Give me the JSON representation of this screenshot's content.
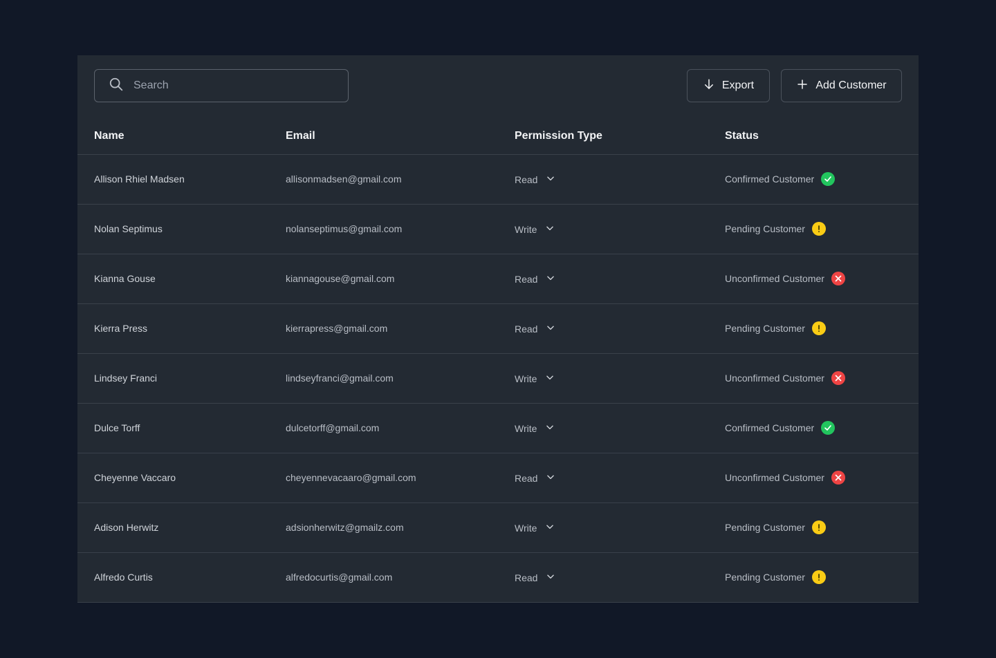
{
  "toolbar": {
    "search_placeholder": "Search",
    "export_label": "Export",
    "add_label": "Add Customer"
  },
  "columns": {
    "name": "Name",
    "email": "Email",
    "permission": "Permission Type",
    "status": "Status"
  },
  "rows": [
    {
      "name": "Allison Rhiel Madsen",
      "email": "allisonmadsen@gmail.com",
      "permission": "Read",
      "status": "Confirmed Customer",
      "status_kind": "confirmed"
    },
    {
      "name": "Nolan Septimus",
      "email": "nolanseptimus@gmail.com",
      "permission": "Write",
      "status": "Pending Customer",
      "status_kind": "pending"
    },
    {
      "name": "Kianna Gouse",
      "email": "kiannagouse@gmail.com",
      "permission": "Read",
      "status": "Unconfirmed Customer",
      "status_kind": "unconfirmed"
    },
    {
      "name": "Kierra Press",
      "email": "kierrapress@gmail.com",
      "permission": "Read",
      "status": "Pending Customer",
      "status_kind": "pending"
    },
    {
      "name": "Lindsey Franci",
      "email": "lindseyfranci@gmail.com",
      "permission": "Write",
      "status": "Unconfirmed Customer",
      "status_kind": "unconfirmed"
    },
    {
      "name": "Dulce Torff",
      "email": "dulcetorff@gmail.com",
      "permission": "Write",
      "status": "Confirmed Customer",
      "status_kind": "confirmed"
    },
    {
      "name": "Cheyenne Vaccaro",
      "email": "cheyennevacaaro@gmail.com",
      "permission": "Read",
      "status": "Unconfirmed Customer",
      "status_kind": "unconfirmed"
    },
    {
      "name": "Adison Herwitz",
      "email": "adsionherwitz@gmailz.com",
      "permission": "Write",
      "status": "Pending Customer",
      "status_kind": "pending"
    },
    {
      "name": "Alfredo Curtis",
      "email": "alfredocurtis@gmail.com",
      "permission": "Read",
      "status": "Pending Customer",
      "status_kind": "pending"
    }
  ],
  "icons": {
    "confirmed": "check-circle-icon",
    "pending": "exclamation-circle-icon",
    "unconfirmed": "x-circle-icon"
  },
  "colors": {
    "confirmed": "#22c55e",
    "pending": "#facc15",
    "unconfirmed": "#ef4444",
    "background": "#111827",
    "panel": "#232a33"
  }
}
